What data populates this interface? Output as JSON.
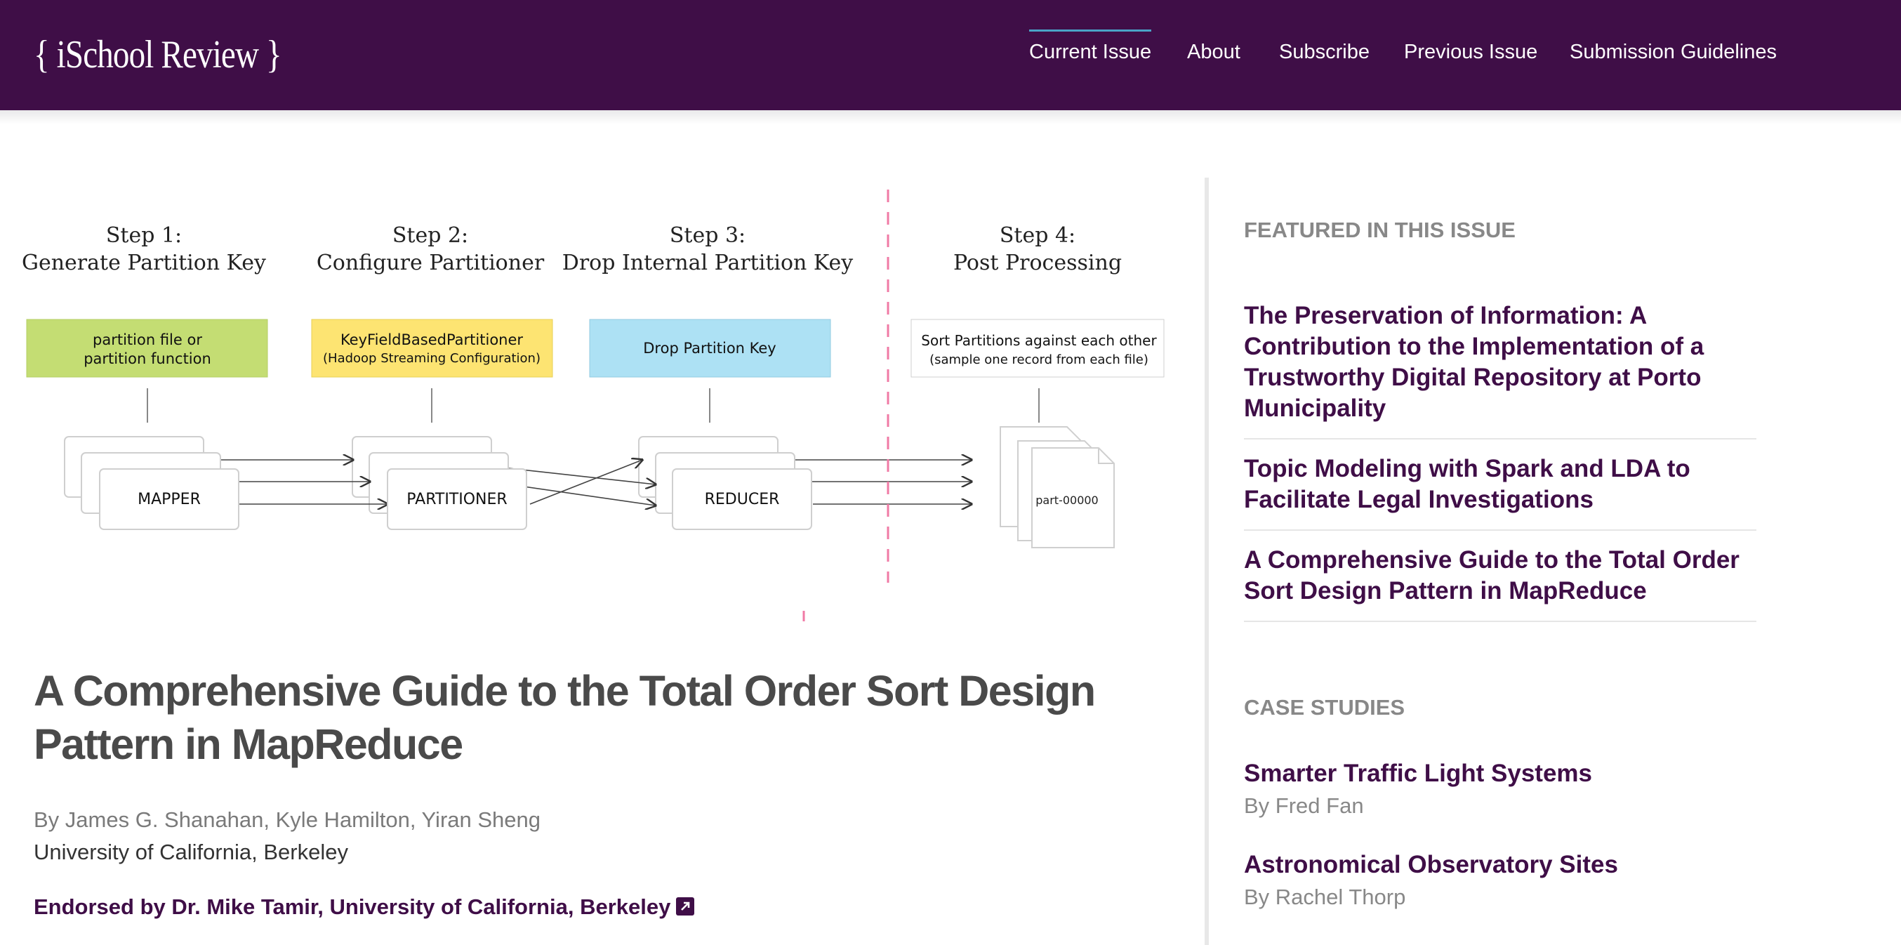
{
  "header": {
    "logo": "{ iSchool Review }",
    "nav": [
      {
        "label": "Current Issue",
        "active": true
      },
      {
        "label": "About"
      },
      {
        "label": "Subscribe"
      },
      {
        "label": "Previous Issue"
      },
      {
        "label": "Submission Guidelines"
      }
    ],
    "colors": {
      "brand": "#3f0e47",
      "active_underline": "#4aa3c7"
    }
  },
  "figure": {
    "steps": [
      {
        "title": "Step 1:",
        "subtitle": "Generate Partition Key",
        "box_lines": [
          "partition file or",
          "partition function"
        ],
        "box_color": "#c4dd73",
        "node": "MAPPER"
      },
      {
        "title": "Step 2:",
        "subtitle": "Configure Partitioner",
        "box_lines": [
          "KeyFieldBasedPartitioner",
          "(Hadoop Streaming Configuration)"
        ],
        "box_color": "#fde472",
        "node": "PARTITIONER"
      },
      {
        "title": "Step 3:",
        "subtitle": "Drop Internal Partition Key",
        "box_lines": [
          "Drop Partition Key"
        ],
        "box_color": "#ade1f4",
        "node": "REDUCER"
      },
      {
        "title": "Step 4:",
        "subtitle": "Post Processing",
        "box_lines": [
          "Sort Partitions against each other",
          "(sample one record from each file)"
        ],
        "box_color": "#ffffff",
        "node": "part-00000"
      }
    ]
  },
  "article": {
    "title": "A Comprehensive Guide to the Total Order Sort Design Pattern in MapReduce",
    "byline": "By James G. Shanahan, Kyle Hamilton, Yiran Sheng",
    "affiliation": "University of California, Berkeley",
    "endorsement": "Endorsed by Dr. Mike Tamir, University of California, Berkeley"
  },
  "sidebar": {
    "featured_heading": "FEATURED IN THIS ISSUE",
    "featured": [
      "The Preservation of Information: A Contribution to the Implementation of a Trustworthy Digital Repository at Porto Municipality",
      "Topic Modeling with Spark and LDA to Facilitate Legal Investigations",
      "A Comprehensive Guide to the Total Order Sort Design Pattern in MapReduce"
    ],
    "case_heading": "CASE STUDIES",
    "cases": [
      {
        "title": "Smarter Traffic Light Systems",
        "author": "By Fred Fan"
      },
      {
        "title": "Astronomical Observatory Sites",
        "author": "By Rachel Thorp"
      }
    ]
  }
}
